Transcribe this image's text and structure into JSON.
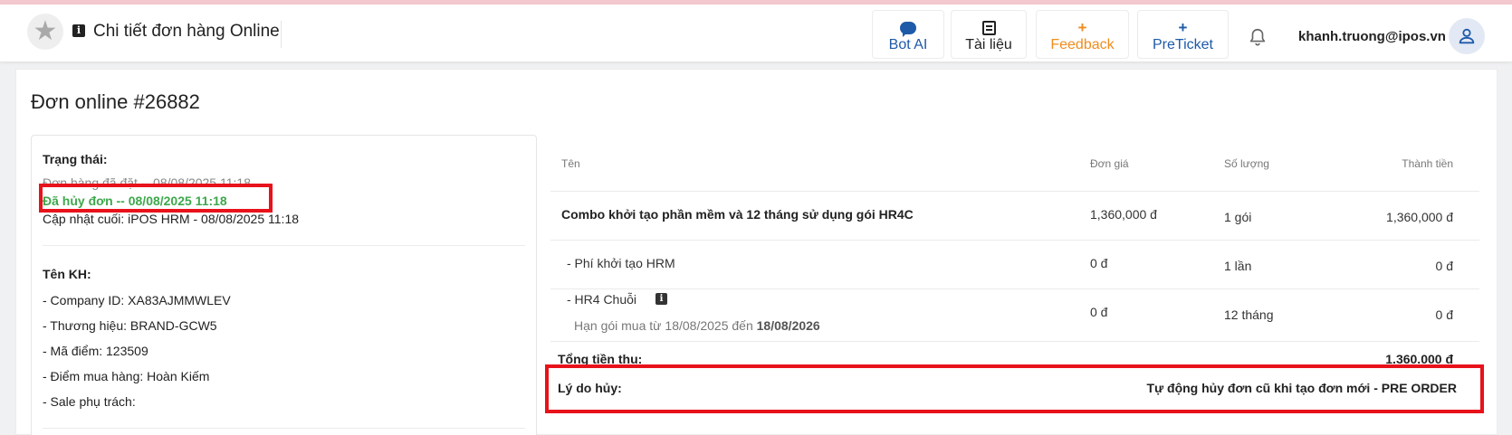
{
  "header": {
    "page_title": "Chi tiết đơn hàng Online",
    "buttons": {
      "bot_ai": "Bot AI",
      "docs": "Tài liệu",
      "feedback": "Feedback",
      "preticket": "PreTicket"
    },
    "user_email": "khanh.truong@ipos.vn"
  },
  "order": {
    "title": "Đơn online #26882",
    "status_label": "Trạng thái:",
    "status_placed": "Đơn hàng đã đặt -- 08/08/2025 11:18",
    "status_cancelled": "Đã hủy đơn -- 08/08/2025 11:18",
    "last_update": "Cập nhật cuối: iPOS HRM - 08/08/2025 11:18",
    "customer_label": "Tên KH:",
    "company_id": "- Company ID: XA83AJMMWLEV",
    "brand": "- Thương hiệu: BRAND-GCW5",
    "store_code": "- Mã điểm: 123509",
    "store_location": "- Điểm mua hàng: Hoàn Kiếm",
    "sale_owner": "- Sale phụ trách:"
  },
  "items_table": {
    "headers": {
      "name": "Tên",
      "unit_price": "Đơn giá",
      "quantity": "Số lượng",
      "amount": "Thành tiền"
    },
    "rows": [
      {
        "name": "Combo khởi tạo phần mềm và 12 tháng sử dụng gói HR4C",
        "unit_price": "1,360,000 đ",
        "quantity": "1 gói",
        "amount": "1,360,000 đ"
      },
      {
        "name": "- Phí khởi tạo HRM",
        "unit_price": "0 đ",
        "quantity": "1 lần",
        "amount": "0 đ"
      },
      {
        "name": "- HR4 Chuỗi",
        "note_prefix": "Hạn gói mua từ 18/08/2025 đến ",
        "note_date": "18/08/2026",
        "unit_price": "0 đ",
        "quantity": "12 tháng",
        "amount": "0 đ"
      }
    ],
    "total_label": "Tổng tiền thu:",
    "total_value": "1.360.000 đ",
    "cancel_reason_label": "Lý do hủy:",
    "cancel_reason_value": "Tự động hủy đơn cũ khi tạo đơn mới - PRE ORDER"
  },
  "colors": {
    "highlight": "#e8121b",
    "status_green": "#3ea84d",
    "accent_blue": "#1e5aa8",
    "feedback_orange": "#f08c1e"
  }
}
